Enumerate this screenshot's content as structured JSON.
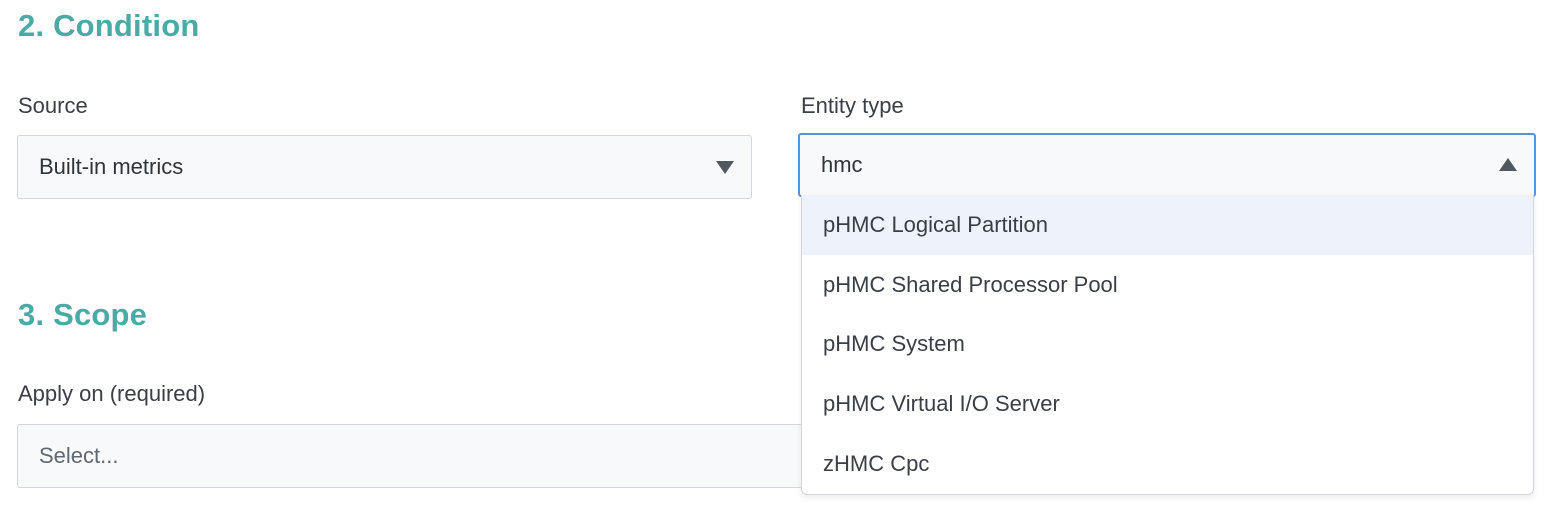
{
  "condition": {
    "title": "2. Condition",
    "source": {
      "label": "Source",
      "value": "Built-in metrics"
    },
    "entity_type": {
      "label": "Entity type",
      "value": "hmc",
      "expanded": true,
      "options": [
        "pHMC Logical Partition",
        "pHMC Shared Processor Pool",
        "pHMC System",
        "pHMC Virtual I/O Server",
        "zHMC Cpc"
      ],
      "highlighted_index": 0
    }
  },
  "scope": {
    "title": "3. Scope",
    "apply_on": {
      "label": "Apply on (required)",
      "placeholder": "Select..."
    }
  },
  "icons": {
    "source_caret": "chevron-down-icon",
    "entity_caret": "chevron-up-icon"
  },
  "colors": {
    "section_title": "#4aaaa6",
    "focus_border": "#5a90e0",
    "field_background": "#f8f9fa",
    "option_highlight": "#eef2fb"
  }
}
